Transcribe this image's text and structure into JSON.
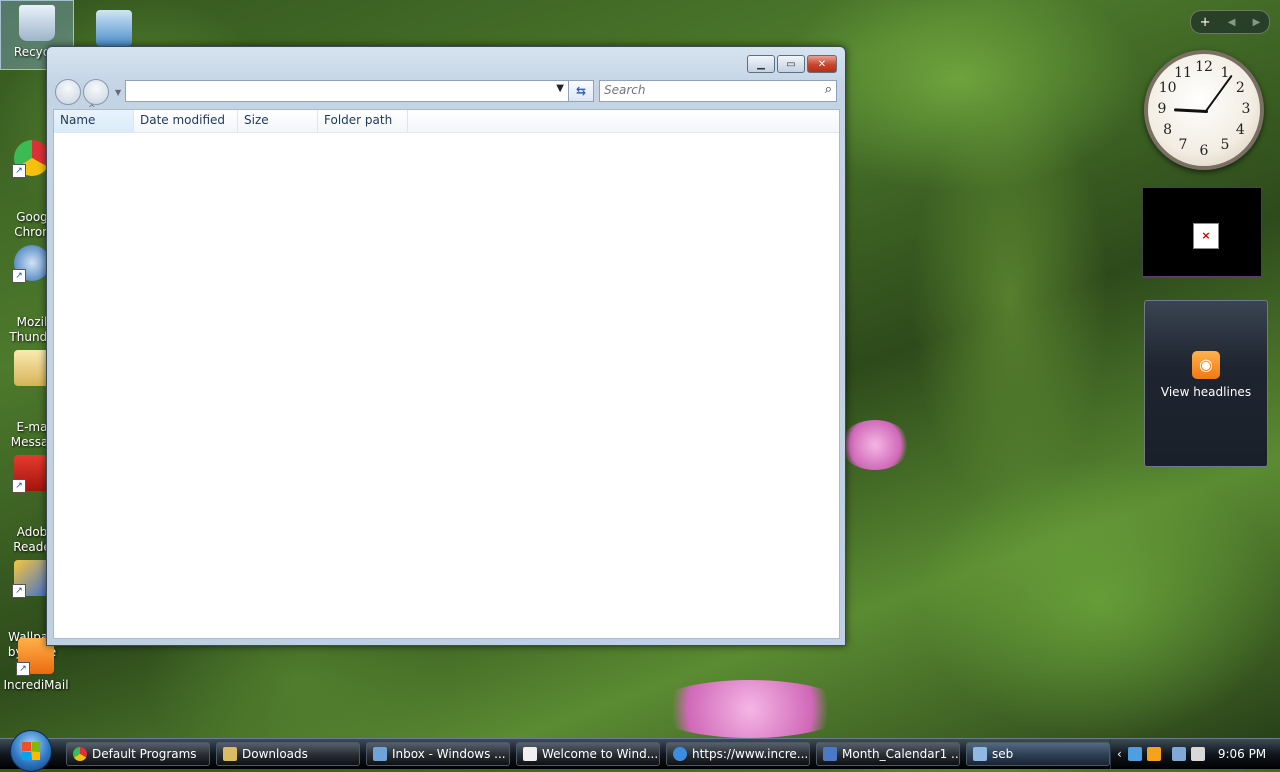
{
  "desktop": {
    "icons": [
      {
        "label": "Recycle",
        "icon": "recycle-bin-icon"
      },
      {
        "label": "Goog\nChron",
        "icon": "chrome-icon"
      },
      {
        "label": "Mozil\nThunde",
        "icon": "thunderbird-icon"
      },
      {
        "label": "E-ma\nMessar",
        "icon": "folder-icon"
      },
      {
        "label": "Adob\nReade",
        "icon": "adobe-reader-icon"
      },
      {
        "label": "Wallpap\nby Incre",
        "icon": "wallpaper-icon"
      },
      {
        "label": "IncrediMail",
        "icon": "incredimail-icon"
      }
    ]
  },
  "explorer": {
    "address_value": "",
    "search_placeholder": "Search",
    "columns": [
      "Name",
      "Date modified",
      "Size",
      "Folder path"
    ]
  },
  "sidebar": {
    "add_label": "+",
    "clock": {
      "hour": 9,
      "minute": 6
    },
    "clock_numbers": [
      "12",
      "1",
      "2",
      "3",
      "4",
      "5",
      "6",
      "7",
      "8",
      "9",
      "10",
      "11"
    ],
    "feed_label": "View headlines",
    "broken_gadget_mark": "×"
  },
  "taskbar": {
    "items": [
      {
        "label": "Default Programs",
        "icon": "default-programs-icon"
      },
      {
        "label": "Downloads",
        "icon": "folder-icon"
      },
      {
        "label": "Inbox - Windows ...",
        "icon": "mail-icon"
      },
      {
        "label": "Welcome to Wind...",
        "icon": "envelope-icon"
      },
      {
        "label": "https://www.incre...",
        "icon": "ie-icon"
      },
      {
        "label": "Month_Calendar1 ...",
        "icon": "document-icon"
      },
      {
        "label": "seb",
        "icon": "search-window-icon"
      }
    ],
    "time": "9:06 PM"
  },
  "colors": {
    "window_frame": "#c4d4e4",
    "close_button": "#c9442a",
    "rss_orange": "#f2790e",
    "taskbar": "#11171e"
  }
}
